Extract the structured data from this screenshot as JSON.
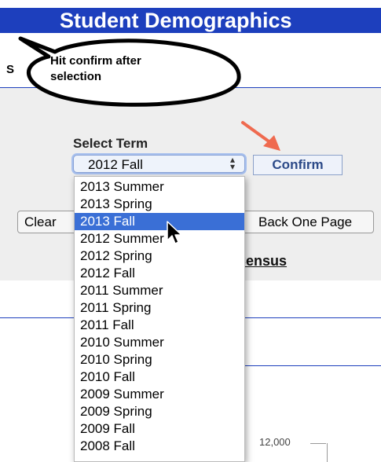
{
  "header": {
    "title": "Student Demographics"
  },
  "section_initial": "S",
  "callout": {
    "line1": "Hit confirm after",
    "line2": "selection"
  },
  "form": {
    "select_label": "Select Term",
    "select_value": "2012 Fall",
    "confirm_label": "Confirm",
    "clear_label": "Clear",
    "back_label": "Back One Page",
    "census_link": "Census"
  },
  "dropdown": {
    "options": [
      "2013 Summer",
      "2013 Spring",
      "2013 Fall",
      "2012 Summer",
      "2012 Spring",
      "2012 Fall",
      "2011 Summer",
      "2011 Spring",
      "2011 Fall",
      "2010 Summer",
      "2010 Spring",
      "2010 Fall",
      "2009 Summer",
      "2009 Spring",
      "2009 Fall",
      "2008 Fall"
    ],
    "highlighted": "2013 Fall"
  },
  "chart": {
    "ytick": "12,000"
  },
  "colors": {
    "header": "#1d3fbd",
    "highlight": "#3a6fd6",
    "arrow": "#ef6a4f"
  },
  "icons": [
    "select-arrows-icon",
    "pointer-cursor-icon",
    "annotation-arrow-icon"
  ]
}
